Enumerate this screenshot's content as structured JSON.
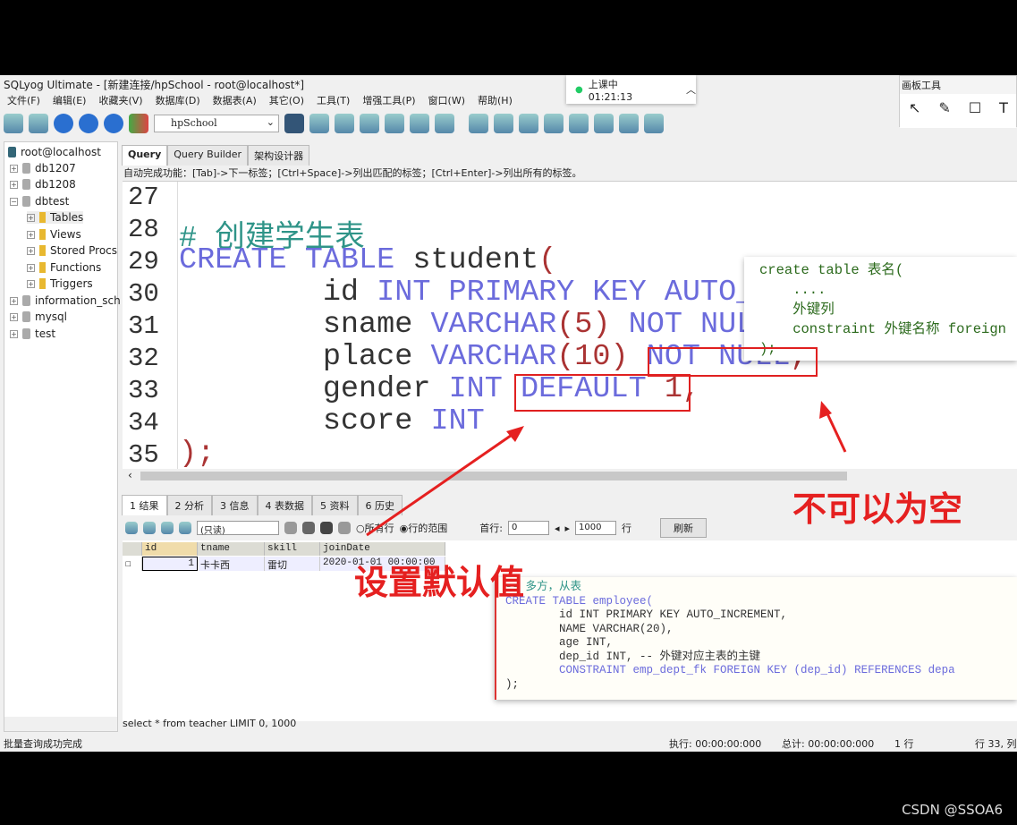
{
  "window": {
    "title": "SQLyog Ultimate - [新建连接/hpSchool - root@localhost*]"
  },
  "menu": [
    "文件(F)",
    "编辑(E)",
    "收藏夹(V)",
    "数据库(D)",
    "数据表(A)",
    "其它(O)",
    "工具(T)",
    "增强工具(P)",
    "窗口(W)",
    "帮助(H)"
  ],
  "toolbar": {
    "database": "hpSchool"
  },
  "tree": {
    "root": "root@localhost",
    "items": [
      "db1207",
      "db1208",
      "dbtest",
      "Tables",
      "Views",
      "Stored Procs",
      "Functions",
      "Triggers",
      "information_sch",
      "mysql",
      "test"
    ]
  },
  "tabs": [
    "Query",
    "Query Builder",
    "架构设计器"
  ],
  "hint": "自动完成功能：[Tab]->下一标签；[Ctrl+Space]->列出匹配的标签；[Ctrl+Enter]->列出所有的标签。",
  "editor": {
    "line_numbers": [
      "27",
      "28",
      "29",
      "30",
      "31",
      "32",
      "33",
      "34",
      "35"
    ],
    "lines": [
      [],
      [
        [
          "cm",
          "# 创建学生表"
        ]
      ],
      [
        [
          "kw",
          "CREATE TABLE "
        ],
        [
          "t",
          "student"
        ],
        [
          "pr",
          "("
        ]
      ],
      [
        [
          "t",
          "        id "
        ],
        [
          "kw",
          "INT PRIMARY KEY AUTO_INCREMENT"
        ],
        [
          "pr",
          ","
        ]
      ],
      [
        [
          "t",
          "        sname "
        ],
        [
          "kw",
          "VARCHAR"
        ],
        [
          "pr",
          "(5) "
        ],
        [
          "kw",
          "NOT NULL"
        ],
        [
          "pr",
          ","
        ]
      ],
      [
        [
          "t",
          "        place "
        ],
        [
          "kw",
          "VARCHAR"
        ],
        [
          "pr",
          "(10) "
        ],
        [
          "kw",
          "NOT NULL"
        ],
        [
          "pr",
          ","
        ]
      ],
      [
        [
          "t",
          "        gender "
        ],
        [
          "kw",
          "INT DEFAULT "
        ],
        [
          "pr",
          "1,"
        ]
      ],
      [
        [
          "t",
          "        score "
        ],
        [
          "kw",
          "INT"
        ]
      ],
      [
        [
          "pr",
          ");"
        ]
      ]
    ]
  },
  "popup_syntax": [
    "create table 表名(",
    "    ....",
    "    外键列",
    "    constraint 外键名称 foreign",
    ");"
  ],
  "result_tabs": [
    "1 结果",
    "2 分析",
    "3 信息",
    "4 表数据",
    "5 资料",
    "6 历史"
  ],
  "result_bar": {
    "mode": "(只读)",
    "all_rows": "所有行",
    "row_range": "行的范围",
    "first_row_label": "首行:",
    "first_row": "0",
    "count": "1000",
    "rows_label": "行",
    "refresh": "刷新"
  },
  "grid": {
    "columns": [
      "id",
      "tname",
      "skill",
      "joinDate"
    ],
    "rows": [
      [
        "1",
        "卡卡西",
        "雷切",
        "2020-01-01 00:00:00"
      ]
    ]
  },
  "popup_employee": [
    "-- 多方，从表",
    "CREATE TABLE employee(",
    "        id INT PRIMARY KEY AUTO_INCREMENT,",
    "        NAME VARCHAR(20),",
    "        age INT,",
    "        dep_id INT, -- 外键对应主表的主键",
    "        CONSTRAINT emp_dept_fk FOREIGN KEY (dep_id) REFERENCES depa",
    ");"
  ],
  "sql_status": "select * from teacher LIMIT 0, 1000",
  "status": {
    "left": "批量查询成功完成",
    "exec": "执行: 00:00:00:000",
    "total": "总计: 00:00:00:000",
    "rows": "1 行",
    "pos": "行 33, 列"
  },
  "annotations": {
    "not_null": "不可以为空",
    "default": "设置默认值"
  },
  "timer": {
    "label": "上课中 01:21:13"
  },
  "draw_tools": {
    "title": "画板工具"
  },
  "watermark": "CSDN @SSOA6",
  "colors": {
    "annotation": "#e52020",
    "keyword": "#6b6bdc",
    "comment": "#2f9488"
  }
}
